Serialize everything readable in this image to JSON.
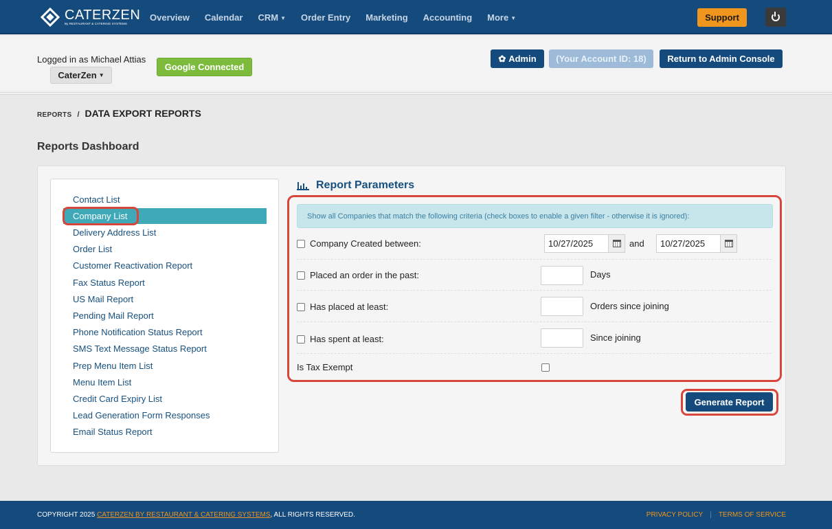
{
  "brand": {
    "name": "CATERZEN",
    "tagline": "By RESTAURANT & CATERING SYSTEMS"
  },
  "nav": {
    "items": [
      {
        "label": "Overview"
      },
      {
        "label": "Calendar"
      },
      {
        "label": "CRM"
      },
      {
        "label": "Order Entry"
      },
      {
        "label": "Marketing"
      },
      {
        "label": "Accounting"
      },
      {
        "label": "More"
      }
    ],
    "support_label": "Support"
  },
  "header": {
    "logged_in": "Logged in as Michael Attias",
    "account_dropdown": "CaterZen",
    "google_label": "Google Connected",
    "admin_label": "Admin",
    "account_id_label": "(Your Account ID: 18)",
    "return_label": "Return to Admin Console"
  },
  "breadcrumb": {
    "first": "REPORTS",
    "separator": "/",
    "current": "DATA EXPORT REPORTS"
  },
  "page_title": "Reports Dashboard",
  "report_menu": {
    "items": [
      {
        "label": "Contact List"
      },
      {
        "label": "Company List"
      },
      {
        "label": "Delivery Address List"
      },
      {
        "label": "Order List"
      },
      {
        "label": "Customer Reactivation Report"
      },
      {
        "label": "Fax Status Report"
      },
      {
        "label": "US Mail Report"
      },
      {
        "label": "Pending Mail Report"
      },
      {
        "label": "Phone Notification Status Report"
      },
      {
        "label": "SMS Text Message Status Report"
      },
      {
        "label": "Prep Menu Item List"
      },
      {
        "label": "Menu Item List"
      },
      {
        "label": "Credit Card Expiry List"
      },
      {
        "label": "Lead Generation Form Responses"
      },
      {
        "label": "Email Status Report"
      }
    ]
  },
  "params": {
    "title": "Report Parameters",
    "info": "Show all Companies that match the following criteria (check boxes to enable a given filter - otherwise it is ignored):",
    "created_label": "Company Created between:",
    "date_from": "10/27/2025",
    "and_label": "and",
    "date_to": "10/27/2025",
    "placed_label": "Placed an order in the past:",
    "placed_unit": "Days",
    "placed_at_least_label": "Has placed at least:",
    "placed_at_least_unit": "Orders since joining",
    "spent_label": "Has spent at least:",
    "spent_unit": "Since joining",
    "tax_label": "Is Tax Exempt",
    "generate_label": "Generate Report"
  },
  "footer": {
    "copyright_prefix": "COPYRIGHT 2025 ",
    "copyright_link": "CATERZEN BY RESTAURANT & CATERING SYSTEMS",
    "copyright_suffix": ", ALL RIGHTS RESERVED.",
    "privacy": "PRIVACY POLICY",
    "terms": "TERMS OF SERVICE"
  },
  "colors": {
    "primary": "#144a7c",
    "accent": "#f0951e",
    "active_item": "#3fa9b8",
    "highlight": "#d8453a",
    "google": "#7dbb3c"
  }
}
